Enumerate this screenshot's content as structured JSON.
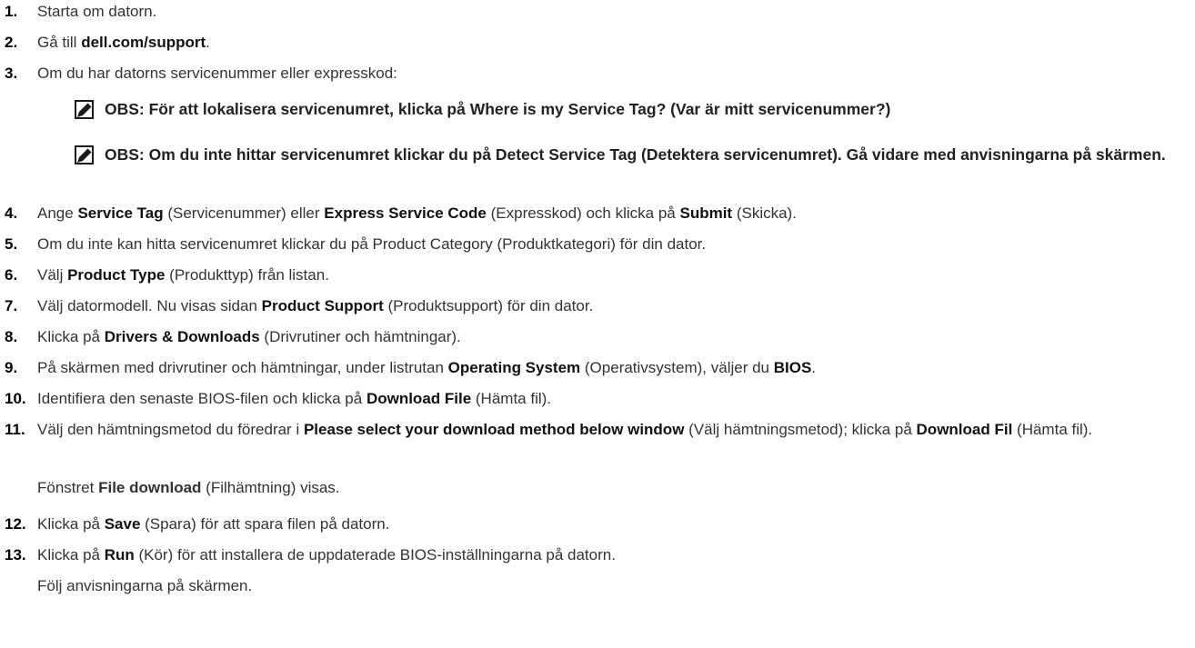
{
  "steps": [
    {
      "num": "1.",
      "parts": [
        {
          "t": "Starta om datorn."
        }
      ]
    },
    {
      "num": "2.",
      "parts": [
        {
          "t": "Gå till "
        },
        {
          "t": "dell.com/support",
          "b": true
        },
        {
          "t": "."
        }
      ]
    },
    {
      "num": "3.",
      "parts": [
        {
          "t": "Om du har datorns servicenummer eller expresskod:"
        }
      ]
    },
    {
      "num": "4.",
      "parts": [
        {
          "t": "Ange "
        },
        {
          "t": "Service Tag",
          "b": true
        },
        {
          "t": " (Servicenummer) eller "
        },
        {
          "t": "Express Service Code",
          "b": true
        },
        {
          "t": " (Expresskod) och klicka på "
        },
        {
          "t": "Submit",
          "b": true
        },
        {
          "t": " (Skicka)."
        }
      ]
    },
    {
      "num": "5.",
      "parts": [
        {
          "t": "Om du inte kan hitta servicenumret klickar du på Product Category (Produktkategori) för din dator."
        }
      ]
    },
    {
      "num": "6.",
      "parts": [
        {
          "t": "Välj "
        },
        {
          "t": "Product Type",
          "b": true
        },
        {
          "t": " (Produkttyp) från listan."
        }
      ]
    },
    {
      "num": "7.",
      "parts": [
        {
          "t": "Välj datormodell. Nu visas sidan "
        },
        {
          "t": "Product Support",
          "b": true
        },
        {
          "t": " (Produktsupport) för din dator."
        }
      ]
    },
    {
      "num": "8.",
      "parts": [
        {
          "t": "Klicka på "
        },
        {
          "t": "Drivers & Downloads",
          "b": true
        },
        {
          "t": " (Drivrutiner och hämtningar)."
        }
      ]
    },
    {
      "num": "9.",
      "parts": [
        {
          "t": "På skärmen med drivrutiner och hämtningar, under listrutan "
        },
        {
          "t": "Operating System",
          "b": true
        },
        {
          "t": " (Operativsystem), väljer du "
        },
        {
          "t": "BIOS",
          "b": true
        },
        {
          "t": "."
        }
      ]
    },
    {
      "num": "10.",
      "parts": [
        {
          "t": "Identifiera den senaste BIOS-filen och klicka på "
        },
        {
          "t": "Download File",
          "b": true
        },
        {
          "t": " (Hämta fil)."
        }
      ]
    },
    {
      "num": "11.",
      "parts": [
        {
          "t": "Välj den hämtningsmetod du föredrar i "
        },
        {
          "t": "Please select your download method below window",
          "b": true
        },
        {
          "t": " (Välj hämtningsmetod); klicka på "
        },
        {
          "t": "Download Fil",
          "b": true
        },
        {
          "t": " (Hämta fil)."
        }
      ]
    },
    {
      "num": "12.",
      "parts": [
        {
          "t": "Klicka på "
        },
        {
          "t": "Save",
          "b": true
        },
        {
          "t": " (Spara) för att spara filen på datorn."
        }
      ]
    },
    {
      "num": "13.",
      "parts": [
        {
          "t": "Klicka på "
        },
        {
          "t": "Run",
          "b": true
        },
        {
          "t": " (Kör) för att installera de uppdaterade BIOS-inställningarna på datorn."
        }
      ]
    }
  ],
  "notes": [
    {
      "text": "OBS: För att lokalisera servicenumret, klicka på Where is my Service Tag? (Var är mitt servicenummer?)",
      "icon": "note-pencil-icon"
    },
    {
      "text": "OBS: Om du inte hittar servicenumret klickar du på Detect Service Tag (Detektera servicenumret). Gå vidare med anvisningarna på skärmen.",
      "icon": "note-pencil-icon"
    }
  ],
  "subtexts": [
    {
      "after_step": "11.",
      "parts": [
        {
          "t": "Fönstret "
        },
        {
          "t": "File download",
          "b": true
        },
        {
          "t": " (Filhämtning) visas."
        }
      ]
    },
    {
      "after_step": "13.",
      "parts": [
        {
          "t": "Följ anvisningarna på skärmen."
        }
      ]
    }
  ],
  "colors": {
    "text": "#333333",
    "bold": "#111111",
    "icon": "#1a1a1a"
  }
}
